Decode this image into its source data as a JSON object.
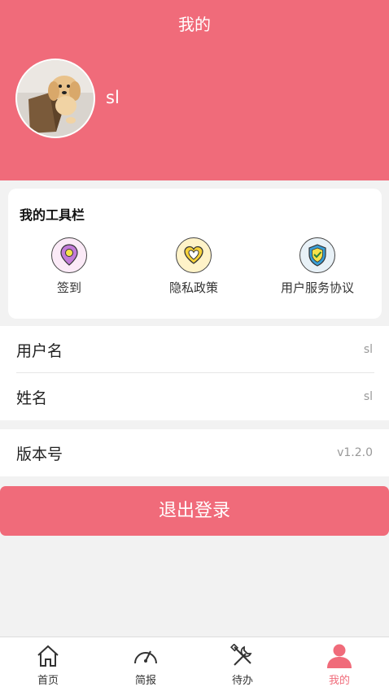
{
  "header": {
    "title": "我的"
  },
  "profile": {
    "name": "sl"
  },
  "toolbar": {
    "title": "我的工具栏",
    "items": [
      {
        "label": "签到",
        "icon": "location-pin-icon"
      },
      {
        "label": "隐私政策",
        "icon": "heart-icon"
      },
      {
        "label": "用户服务协议",
        "icon": "shield-check-icon"
      }
    ]
  },
  "account": {
    "rows": [
      {
        "label": "用户名",
        "value": "sl"
      },
      {
        "label": "姓名",
        "value": "sl"
      }
    ]
  },
  "version": {
    "label": "版本号",
    "value": "v1.2.0"
  },
  "logout": {
    "label": "退出登录"
  },
  "tabbar": {
    "items": [
      {
        "label": "首页",
        "icon": "home-icon"
      },
      {
        "label": "简报",
        "icon": "gauge-icon"
      },
      {
        "label": "待办",
        "icon": "tools-icon"
      },
      {
        "label": "我的",
        "icon": "user-icon",
        "active": true
      }
    ]
  },
  "colors": {
    "accent": "#f06b7a",
    "background": "#f2f2f2"
  }
}
